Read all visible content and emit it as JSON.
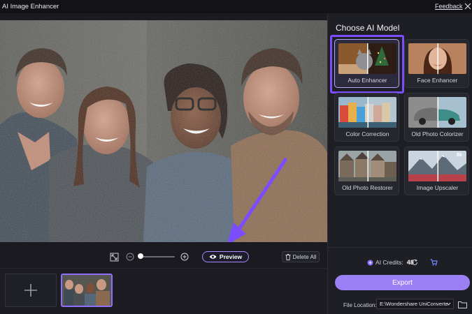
{
  "window": {
    "title": "AI Image Enhancer",
    "feedback_label": "Feedback"
  },
  "toolbar": {
    "preview_label": "Preview",
    "delete_all_label": "Delete All",
    "zoom_level": 0.05
  },
  "panel": {
    "title": "Choose AI Model",
    "models": [
      {
        "label": "Auto Enhancer",
        "selected": true
      },
      {
        "label": "Face Enhancer",
        "selected": false
      },
      {
        "label": "Color Correction",
        "selected": false
      },
      {
        "label": "Old Photo Colorizer",
        "selected": false
      },
      {
        "label": "Old Photo Restorer",
        "selected": false
      },
      {
        "label": "Image Upscaler",
        "selected": false
      }
    ],
    "upscale_badge": "8k",
    "credits_label": "AI Credits:",
    "credits_value": "48",
    "export_label": "Export",
    "file_location_label": "File Location:",
    "file_location_value": "E:\\Wondershare UniConverte"
  },
  "colors": {
    "accent": "#7b4dff",
    "export": "#9b7ff5",
    "bg": "#1a1a20",
    "panel": "#1e1e25"
  }
}
